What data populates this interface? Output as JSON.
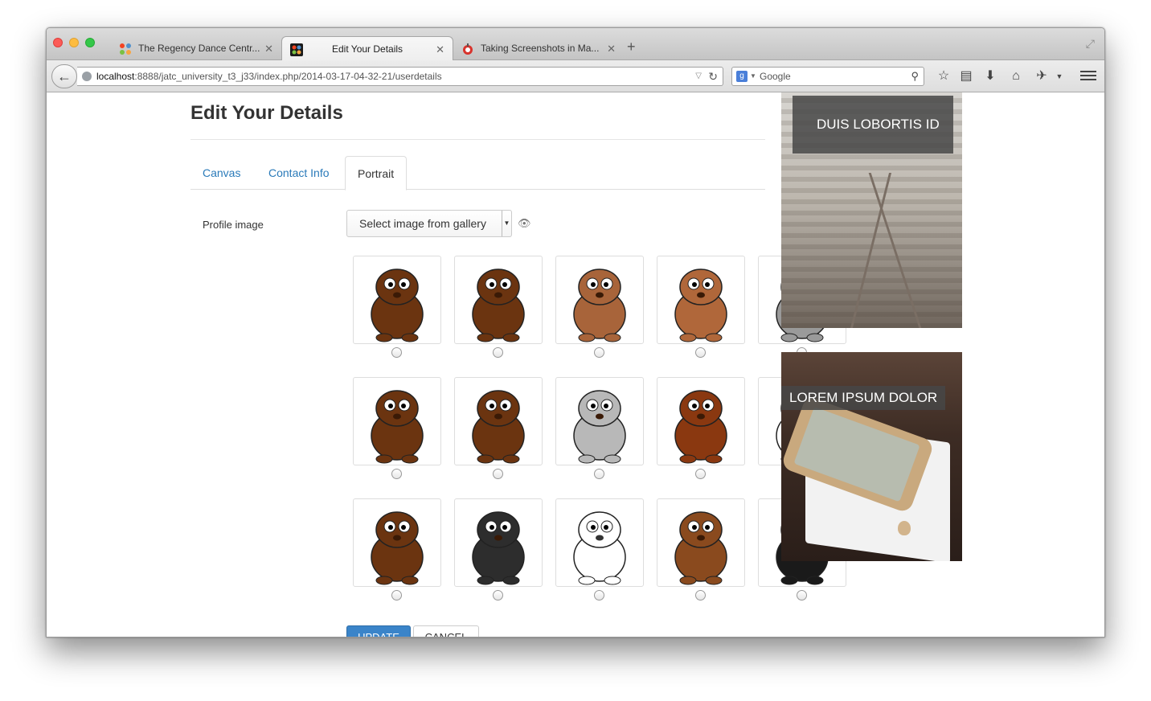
{
  "browser": {
    "tabs": [
      {
        "title": "The Regency Dance Centr...",
        "active": false
      },
      {
        "title": "Edit Your Details",
        "active": true
      },
      {
        "title": "Taking Screenshots in Ma...",
        "active": false
      }
    ],
    "new_tab_label": "+",
    "url_host": "localhost",
    "url_rest": ":8888/jatc_university_t3_j33/index.php/2014-03-17-04-32-21/userdetails",
    "search_placeholder": "Google"
  },
  "page": {
    "title": "Edit Your Details",
    "tabs": [
      {
        "label": "Canvas",
        "active": false
      },
      {
        "label": "Contact Info",
        "active": false
      },
      {
        "label": "Portrait",
        "active": true
      }
    ],
    "profile_label": "Profile image",
    "select_value": "Select image from gallery",
    "update_label": "UPDATE",
    "cancel_label": "CANCEL"
  },
  "gallery": [
    {
      "animal": "bear",
      "color": "#6b3410"
    },
    {
      "animal": "beaver",
      "color": "#6b3410"
    },
    {
      "animal": "cat",
      "color": "#a8643a"
    },
    {
      "animal": "dog",
      "color": "#b0673a"
    },
    {
      "animal": "elephant",
      "color": "#9a9a9a"
    },
    {
      "animal": "moose",
      "color": "#6b3410"
    },
    {
      "animal": "yak",
      "color": "#6b3410"
    },
    {
      "animal": "goat",
      "color": "#b8b8b8"
    },
    {
      "animal": "kangaroo",
      "color": "#8a3810"
    },
    {
      "animal": "mouse",
      "color": "#ffffff"
    },
    {
      "animal": "owl",
      "color": "#6b3410"
    },
    {
      "animal": "penguin",
      "color": "#2d2d2d"
    },
    {
      "animal": "sheep",
      "color": "#ffffff"
    },
    {
      "animal": "squirrel",
      "color": "#8a4a1e"
    },
    {
      "animal": "penguin",
      "color": "#1a1a1a"
    }
  ],
  "banners": [
    {
      "caption": "DUIS LOBORTIS ID"
    },
    {
      "caption": "LOREM IPSUM DOLOR"
    }
  ]
}
